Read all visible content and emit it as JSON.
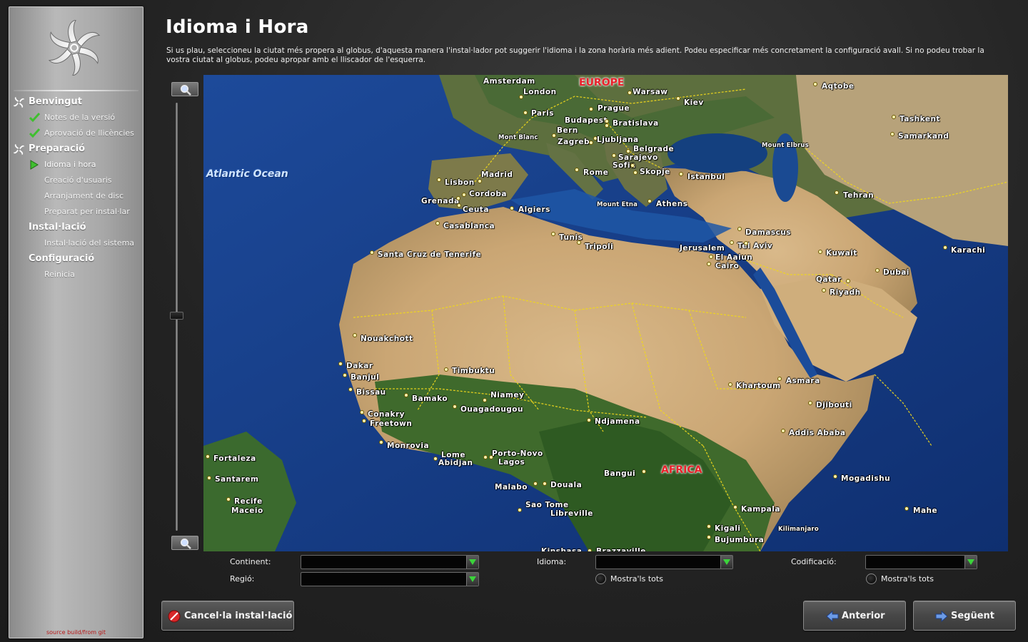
{
  "sidebar": {
    "sections": [
      {
        "label": "Benvingut",
        "items": [
          {
            "label": "Notes de la versió",
            "state": "done"
          },
          {
            "label": "Aprovació de llicències",
            "state": "done"
          }
        ]
      },
      {
        "label": "Preparació",
        "items": [
          {
            "label": "Idioma i hora",
            "state": "current"
          },
          {
            "label": "Creació d'usuaris",
            "state": "pending"
          },
          {
            "label": "Arranjament de disc",
            "state": "pending"
          },
          {
            "label": "Preparat per instal·lar",
            "state": "pending"
          }
        ]
      },
      {
        "label": "Instal·lació",
        "items": [
          {
            "label": "Instal·lació del sistema",
            "state": "pending"
          }
        ]
      },
      {
        "label": "Configuració",
        "items": [
          {
            "label": "Reinicia",
            "state": "pending"
          }
        ]
      }
    ],
    "build_label": "source build/from git"
  },
  "page": {
    "title": "Idioma i Hora",
    "description": "Si us plau, seleccioneu la ciutat més propera al globus, d'aquesta manera l'instal·lador pot suggerir l'idioma i la zona horària més adient. Podeu especificar més concretament la configuració avall. Si no podeu trobar la vostra ciutat al globus, podeu apropar amb el lliscador de l'esquerra."
  },
  "map": {
    "region_labels": [
      "EUROPE",
      "AFRICA"
    ],
    "ocean_label": "Atlantic Ocean",
    "cities": [
      "Amsterdam",
      "London",
      "Warsaw",
      "Prague",
      "Paris",
      "Kiev",
      "Budapest",
      "Bratislava",
      "Bern",
      "Mont Blanc",
      "Zagreb",
      "Ljubljana",
      "Belgrade",
      "Sarajevo",
      "Sofia",
      "Skopje",
      "Rome",
      "Madrid",
      "Lisbon",
      "Cordoba",
      "Grenada",
      "Ceuta",
      "Algiers",
      "Casablanca",
      "Mount Etna",
      "Athens",
      "Istanbul",
      "Tunis",
      "Tripoli",
      "Santa Cruz de Tenerife",
      "Damascus",
      "Tel Aviv",
      "Jerusalem",
      "El Aaiun",
      "Cairo",
      "Mount Elbrus",
      "Aqtobe",
      "Tashkent",
      "Samarkand",
      "Tehran",
      "Kuwait",
      "Karachi",
      "Qatar",
      "Riyadh",
      "Dubai",
      "Nouakchott",
      "Timbuktu",
      "Dakar",
      "Banjul",
      "Bissau",
      "Bamako",
      "Niamey",
      "Ouagadougou",
      "Conakry",
      "Freetown",
      "Monrovia",
      "Lome",
      "Abidjan",
      "Porto-Novo",
      "Lagos",
      "Ndjamena",
      "Khartoum",
      "Asmara",
      "Djibouti",
      "Addis Ababa",
      "Bangui",
      "Malabo",
      "Douala",
      "Sao Tome",
      "Libreville",
      "Mogadishu",
      "Kampala",
      "Kigali",
      "Bujumbura",
      "Kilimanjaro",
      "Mahe",
      "Fortaleza",
      "Santarem",
      "Recife",
      "Maceio",
      "Kinshasa",
      "Brazzaville"
    ]
  },
  "form": {
    "continent_label": "Continent:",
    "continent_value": "",
    "region_label": "Regió:",
    "region_value": "",
    "language_label": "Idioma:",
    "language_value": "",
    "encoding_label": "Codificació:",
    "encoding_value": "",
    "show_all_language": "Mostra'ls tots",
    "show_all_encoding": "Mostra'ls tots"
  },
  "buttons": {
    "cancel": "Cancel·la instal·lació",
    "back": "Anterior",
    "next": "Següent"
  },
  "colors": {
    "done_check": "#3fbf2f",
    "current_arrow": "#3fbf2f",
    "region_label": "#e8202a",
    "combo_arrow": "#3bd43b"
  }
}
